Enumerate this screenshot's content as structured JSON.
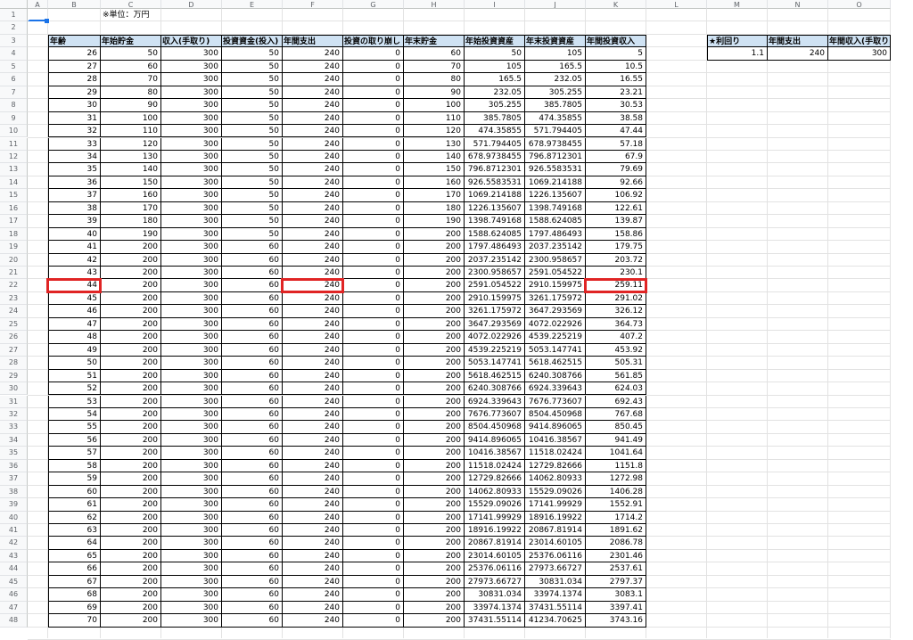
{
  "sheet": {
    "columns": [
      "A",
      "B",
      "C",
      "D",
      "E",
      "F",
      "G",
      "H",
      "I",
      "J",
      "K",
      "L",
      "M",
      "N",
      "O"
    ],
    "unit_note": "※単位：万円",
    "headers": [
      "年齢",
      "年始貯金",
      "収入(手取り)",
      "投資資金(投入)",
      "年間支出",
      "投資の取り崩し",
      "年末貯金",
      "年始投資資産",
      "年末投資資産",
      "年間投資収入"
    ],
    "rows": [
      [
        "26",
        "50",
        "300",
        "50",
        "240",
        "0",
        "60",
        "50",
        "105",
        "5"
      ],
      [
        "27",
        "60",
        "300",
        "50",
        "240",
        "0",
        "70",
        "105",
        "165.5",
        "10.5"
      ],
      [
        "28",
        "70",
        "300",
        "50",
        "240",
        "0",
        "80",
        "165.5",
        "232.05",
        "16.55"
      ],
      [
        "29",
        "80",
        "300",
        "50",
        "240",
        "0",
        "90",
        "232.05",
        "305.255",
        "23.21"
      ],
      [
        "30",
        "90",
        "300",
        "50",
        "240",
        "0",
        "100",
        "305.255",
        "385.7805",
        "30.53"
      ],
      [
        "31",
        "100",
        "300",
        "50",
        "240",
        "0",
        "110",
        "385.7805",
        "474.35855",
        "38.58"
      ],
      [
        "32",
        "110",
        "300",
        "50",
        "240",
        "0",
        "120",
        "474.35855",
        "571.794405",
        "47.44"
      ],
      [
        "33",
        "120",
        "300",
        "50",
        "240",
        "0",
        "130",
        "571.794405",
        "678.9738455",
        "57.18"
      ],
      [
        "34",
        "130",
        "300",
        "50",
        "240",
        "0",
        "140",
        "678.9738455",
        "796.8712301",
        "67.9"
      ],
      [
        "35",
        "140",
        "300",
        "50",
        "240",
        "0",
        "150",
        "796.8712301",
        "926.5583531",
        "79.69"
      ],
      [
        "36",
        "150",
        "300",
        "50",
        "240",
        "0",
        "160",
        "926.5583531",
        "1069.214188",
        "92.66"
      ],
      [
        "37",
        "160",
        "300",
        "50",
        "240",
        "0",
        "170",
        "1069.214188",
        "1226.135607",
        "106.92"
      ],
      [
        "38",
        "170",
        "300",
        "50",
        "240",
        "0",
        "180",
        "1226.135607",
        "1398.749168",
        "122.61"
      ],
      [
        "39",
        "180",
        "300",
        "50",
        "240",
        "0",
        "190",
        "1398.749168",
        "1588.624085",
        "139.87"
      ],
      [
        "40",
        "190",
        "300",
        "50",
        "240",
        "0",
        "200",
        "1588.624085",
        "1797.486493",
        "158.86"
      ],
      [
        "41",
        "200",
        "300",
        "60",
        "240",
        "0",
        "200",
        "1797.486493",
        "2037.235142",
        "179.75"
      ],
      [
        "42",
        "200",
        "300",
        "60",
        "240",
        "0",
        "200",
        "2037.235142",
        "2300.958657",
        "203.72"
      ],
      [
        "43",
        "200",
        "300",
        "60",
        "240",
        "0",
        "200",
        "2300.958657",
        "2591.054522",
        "230.1"
      ],
      [
        "44",
        "200",
        "300",
        "60",
        "240",
        "0",
        "200",
        "2591.054522",
        "2910.159975",
        "259.11"
      ],
      [
        "45",
        "200",
        "300",
        "60",
        "240",
        "0",
        "200",
        "2910.159975",
        "3261.175972",
        "291.02"
      ],
      [
        "46",
        "200",
        "300",
        "60",
        "240",
        "0",
        "200",
        "3261.175972",
        "3647.293569",
        "326.12"
      ],
      [
        "47",
        "200",
        "300",
        "60",
        "240",
        "0",
        "200",
        "3647.293569",
        "4072.022926",
        "364.73"
      ],
      [
        "48",
        "200",
        "300",
        "60",
        "240",
        "0",
        "200",
        "4072.022926",
        "4539.225219",
        "407.2"
      ],
      [
        "49",
        "200",
        "300",
        "60",
        "240",
        "0",
        "200",
        "4539.225219",
        "5053.147741",
        "453.92"
      ],
      [
        "50",
        "200",
        "300",
        "60",
        "240",
        "0",
        "200",
        "5053.147741",
        "5618.462515",
        "505.31"
      ],
      [
        "51",
        "200",
        "300",
        "60",
        "240",
        "0",
        "200",
        "5618.462515",
        "6240.308766",
        "561.85"
      ],
      [
        "52",
        "200",
        "300",
        "60",
        "240",
        "0",
        "200",
        "6240.308766",
        "6924.339643",
        "624.03"
      ],
      [
        "53",
        "200",
        "300",
        "60",
        "240",
        "0",
        "200",
        "6924.339643",
        "7676.773607",
        "692.43"
      ],
      [
        "54",
        "200",
        "300",
        "60",
        "240",
        "0",
        "200",
        "7676.773607",
        "8504.450968",
        "767.68"
      ],
      [
        "55",
        "200",
        "300",
        "60",
        "240",
        "0",
        "200",
        "8504.450968",
        "9414.896065",
        "850.45"
      ],
      [
        "56",
        "200",
        "300",
        "60",
        "240",
        "0",
        "200",
        "9414.896065",
        "10416.38567",
        "941.49"
      ],
      [
        "57",
        "200",
        "300",
        "60",
        "240",
        "0",
        "200",
        "10416.38567",
        "11518.02424",
        "1041.64"
      ],
      [
        "58",
        "200",
        "300",
        "60",
        "240",
        "0",
        "200",
        "11518.02424",
        "12729.82666",
        "1151.8"
      ],
      [
        "59",
        "200",
        "300",
        "60",
        "240",
        "0",
        "200",
        "12729.82666",
        "14062.80933",
        "1272.98"
      ],
      [
        "60",
        "200",
        "300",
        "60",
        "240",
        "0",
        "200",
        "14062.80933",
        "15529.09026",
        "1406.28"
      ],
      [
        "61",
        "200",
        "300",
        "60",
        "240",
        "0",
        "200",
        "15529.09026",
        "17141.99929",
        "1552.91"
      ],
      [
        "62",
        "200",
        "300",
        "60",
        "240",
        "0",
        "200",
        "17141.99929",
        "18916.19922",
        "1714.2"
      ],
      [
        "63",
        "200",
        "300",
        "60",
        "240",
        "0",
        "200",
        "18916.19922",
        "20867.81914",
        "1891.62"
      ],
      [
        "64",
        "200",
        "300",
        "60",
        "240",
        "0",
        "200",
        "20867.81914",
        "23014.60105",
        "2086.78"
      ],
      [
        "65",
        "200",
        "300",
        "60",
        "240",
        "0",
        "200",
        "23014.60105",
        "25376.06116",
        "2301.46"
      ],
      [
        "66",
        "200",
        "300",
        "60",
        "240",
        "0",
        "200",
        "25376.06116",
        "27973.66727",
        "2537.61"
      ],
      [
        "67",
        "200",
        "300",
        "60",
        "240",
        "0",
        "200",
        "27973.66727",
        "30831.034",
        "2797.37"
      ],
      [
        "68",
        "200",
        "300",
        "60",
        "240",
        "0",
        "200",
        "30831.034",
        "33974.1374",
        "3083.1"
      ],
      [
        "69",
        "200",
        "300",
        "60",
        "240",
        "0",
        "200",
        "33974.1374",
        "37431.55114",
        "3397.41"
      ],
      [
        "70",
        "200",
        "300",
        "60",
        "240",
        "0",
        "200",
        "37431.55114",
        "41234.70625",
        "3743.16"
      ]
    ],
    "side_headers": [
      "★利回り",
      "年間支出",
      "年間収入(手取り)"
    ],
    "side_values": [
      "1.1",
      "240",
      "300"
    ],
    "highlighted_cells": [
      "B22",
      "F22",
      "K22"
    ],
    "selected_cell": "A1",
    "colors": {
      "header_fill": "#cfe2f3",
      "highlight_border": "#e02424",
      "selection": "#1a73e8"
    }
  }
}
